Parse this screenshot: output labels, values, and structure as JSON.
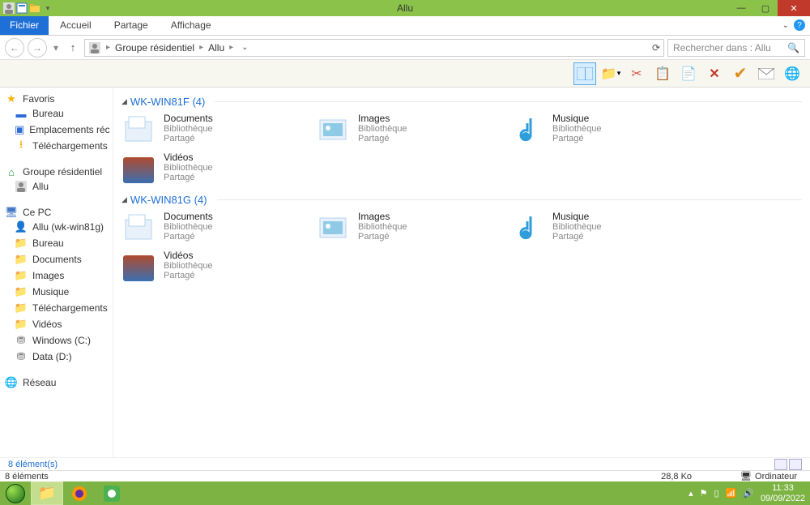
{
  "window": {
    "title": "Allu"
  },
  "ribbon": {
    "file": "Fichier",
    "tabs": [
      "Accueil",
      "Partage",
      "Affichage"
    ]
  },
  "breadcrumb": {
    "items": [
      "Groupe résidentiel",
      "Allu"
    ]
  },
  "search": {
    "placeholder": "Rechercher dans : Allu"
  },
  "sidebar": {
    "favoris": {
      "label": "Favoris",
      "items": [
        {
          "label": "Bureau"
        },
        {
          "label": "Emplacements récen"
        },
        {
          "label": "Téléchargements"
        }
      ]
    },
    "groupe": {
      "label": "Groupe résidentiel",
      "items": [
        {
          "label": "Allu"
        }
      ]
    },
    "cepc": {
      "label": "Ce PC",
      "items": [
        {
          "label": "Allu (wk-win81g)"
        },
        {
          "label": "Bureau"
        },
        {
          "label": "Documents"
        },
        {
          "label": "Images"
        },
        {
          "label": "Musique"
        },
        {
          "label": "Téléchargements"
        },
        {
          "label": "Vidéos"
        },
        {
          "label": "Windows (C:)"
        },
        {
          "label": "Data (D:)"
        }
      ]
    },
    "reseau": {
      "label": "Réseau"
    }
  },
  "sections": [
    {
      "title": "WK-WIN81F (4)",
      "items": [
        {
          "name": "Documents",
          "l1": "Bibliothèque",
          "l2": "Partagé",
          "kind": "doc"
        },
        {
          "name": "Images",
          "l1": "Bibliothèque",
          "l2": "Partagé",
          "kind": "img"
        },
        {
          "name": "Musique",
          "l1": "Bibliothèque",
          "l2": "Partagé",
          "kind": "mus"
        },
        {
          "name": "Vidéos",
          "l1": "Bibliothèque",
          "l2": "Partagé",
          "kind": "vid"
        }
      ]
    },
    {
      "title": "WK-WIN81G (4)",
      "items": [
        {
          "name": "Documents",
          "l1": "Bibliothèque",
          "l2": "Partagé",
          "kind": "doc"
        },
        {
          "name": "Images",
          "l1": "Bibliothèque",
          "l2": "Partagé",
          "kind": "img"
        },
        {
          "name": "Musique",
          "l1": "Bibliothèque",
          "l2": "Partagé",
          "kind": "mus"
        },
        {
          "name": "Vidéos",
          "l1": "Bibliothèque",
          "l2": "Partagé",
          "kind": "vid"
        }
      ]
    }
  ],
  "inner_status": {
    "text": "8 élément(s)"
  },
  "outer_status": {
    "count": "8 éléments",
    "size": "28,8 Ko",
    "computer": "Ordinateur"
  },
  "tray": {
    "time": "11:33",
    "date": "09/09/2022"
  }
}
